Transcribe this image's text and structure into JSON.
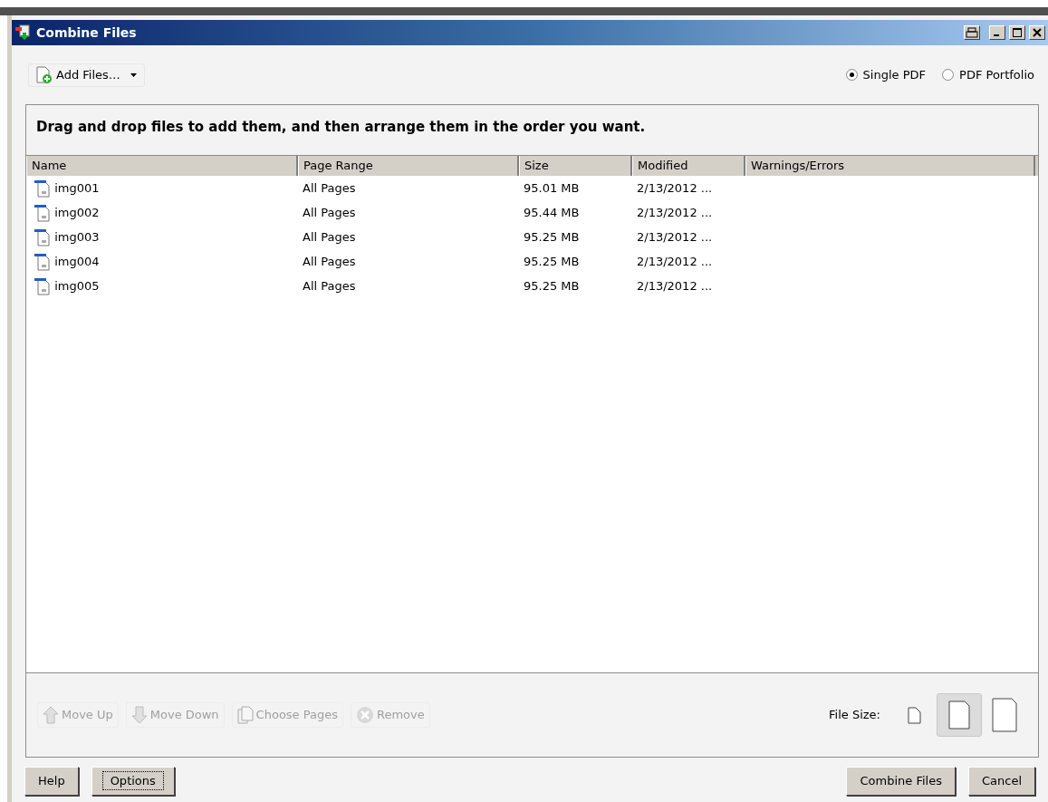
{
  "window": {
    "title": "Combine Files"
  },
  "toolbar": {
    "add_button": "Add Files…",
    "output": [
      {
        "label": "Single PDF",
        "selected": true
      },
      {
        "label": "PDF Portfolio",
        "selected": false
      }
    ]
  },
  "instruction": "Drag and drop files to add them, and then arrange them in the order you want.",
  "table": {
    "columns": [
      "Name",
      "Page Range",
      "Size",
      "Modified",
      "Warnings/Errors"
    ],
    "rows": [
      {
        "name": "img001",
        "page_range": "All Pages",
        "size": "95.01 MB",
        "modified": "2/13/2012 ..."
      },
      {
        "name": "img002",
        "page_range": "All Pages",
        "size": "95.44 MB",
        "modified": "2/13/2012 ..."
      },
      {
        "name": "img003",
        "page_range": "All Pages",
        "size": "95.25 MB",
        "modified": "2/13/2012 ..."
      },
      {
        "name": "img004",
        "page_range": "All Pages",
        "size": "95.25 MB",
        "modified": "2/13/2012 ..."
      },
      {
        "name": "img005",
        "page_range": "All Pages",
        "size": "95.25 MB",
        "modified": "2/13/2012 ..."
      }
    ]
  },
  "actions": [
    {
      "kind": "up",
      "label": "Move Up",
      "disabled": true
    },
    {
      "kind": "down",
      "label": "Move Down",
      "disabled": true
    },
    {
      "kind": "pages",
      "label": "Choose Pages",
      "disabled": true
    },
    {
      "kind": "remove",
      "label": "Remove",
      "disabled": true
    }
  ],
  "file_size": {
    "label": "File Size:",
    "options": [
      {
        "kind": "small",
        "selected": false
      },
      {
        "kind": "medium",
        "selected": true
      },
      {
        "kind": "large",
        "selected": false
      }
    ]
  },
  "buttons_left": [
    {
      "label": "Help",
      "focused": false
    },
    {
      "label": "Options",
      "focused": true
    }
  ],
  "buttons_right": [
    {
      "label": "Combine Files",
      "focused": false
    },
    {
      "label": "Cancel",
      "focused": false
    }
  ]
}
